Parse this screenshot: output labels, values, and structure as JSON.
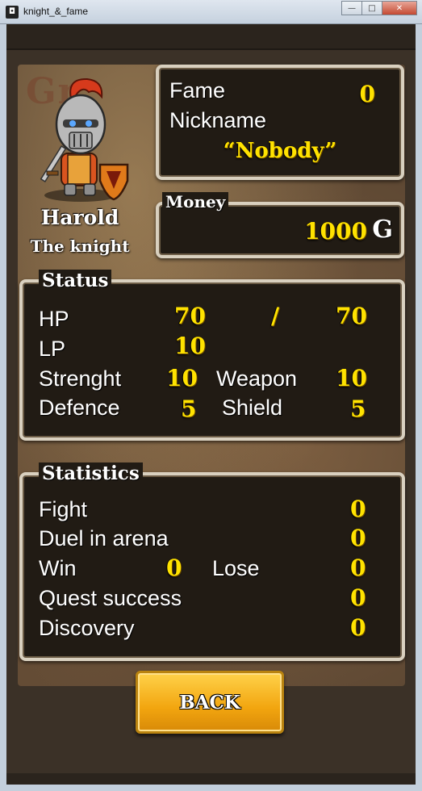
{
  "window": {
    "title": "knight_&_fame",
    "minimize": "—",
    "maximize": "□",
    "close": "✕"
  },
  "hero": {
    "name": "Harold",
    "title": "The knight"
  },
  "fame_panel": {
    "fame_label": "Fame",
    "fame_value": "0",
    "nickname_label": "Nickname",
    "nickname_value": "“Nobody”"
  },
  "money_panel": {
    "title": "Money",
    "value": "1000",
    "currency_symbol": "G"
  },
  "status_panel": {
    "title": "Status",
    "hp_label": "HP",
    "hp_current": "70",
    "hp_sep": "/",
    "hp_max": "70",
    "lp_label": "LP",
    "lp_value": "10",
    "strength_label": "Strenght",
    "strength_value": "10",
    "weapon_label": "Weapon",
    "weapon_value": "10",
    "defence_label": "Defence",
    "defence_value": "5",
    "shield_label": "Shield",
    "shield_value": "5"
  },
  "statistics_panel": {
    "title": "Statistics",
    "fight_label": "Fight",
    "fight_value": "0",
    "duel_label": "Duel in arena",
    "duel_value": "0",
    "win_label": "Win",
    "win_value": "0",
    "lose_label": "Lose",
    "lose_value": "0",
    "quest_label": "Quest success",
    "quest_value": "0",
    "discovery_label": "Discovery",
    "discovery_value": "0"
  },
  "buttons": {
    "back": "BACK"
  },
  "map_watermark": "Gr",
  "colors": {
    "value_yellow": "#ffe200",
    "panel_bg": "#211b14",
    "panel_border": "#d9d0bf",
    "button": "#f2a50f"
  }
}
